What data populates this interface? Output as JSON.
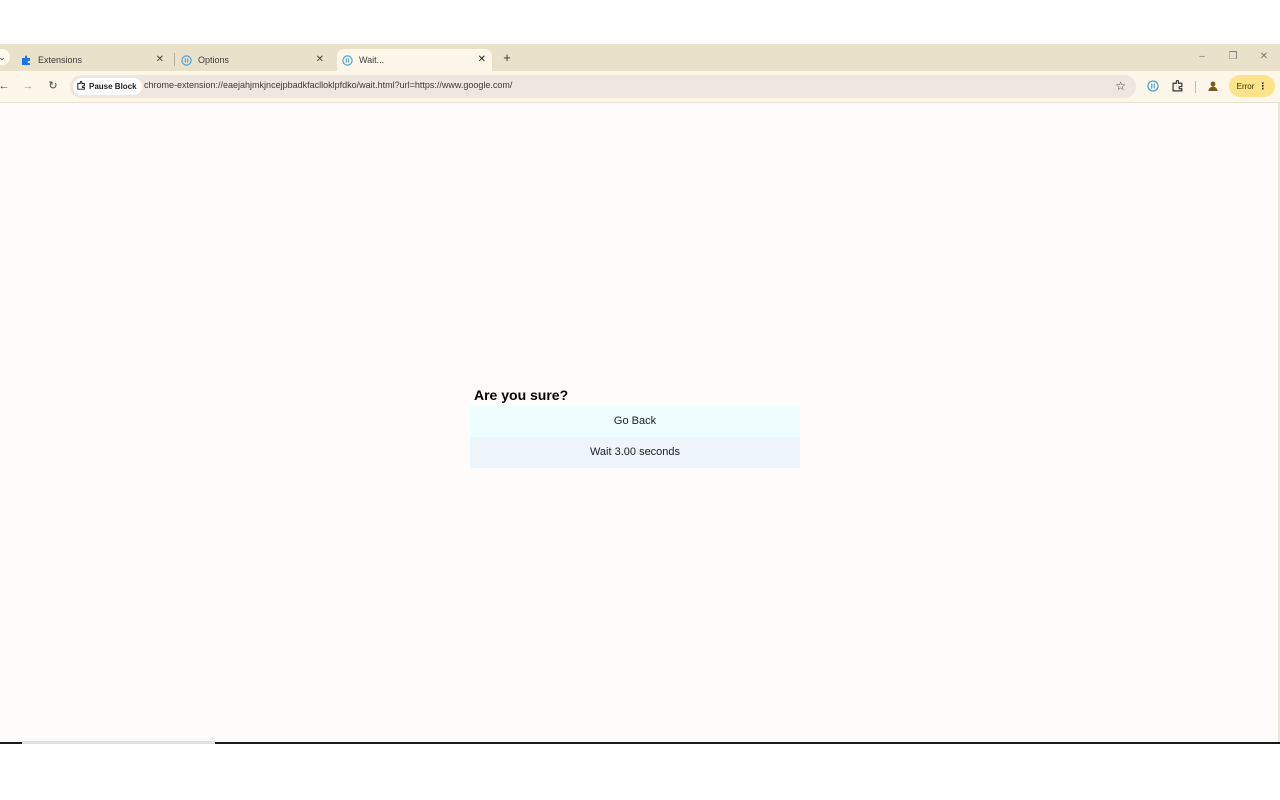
{
  "browser": {
    "tabs": [
      {
        "label": "Extensions",
        "icon": "puzzle-icon"
      },
      {
        "label": "Options",
        "icon": "pause-circle-icon"
      },
      {
        "label": "Wait...",
        "icon": "pause-circle-icon",
        "active": true
      }
    ],
    "toolbar": {
      "chip_label": "Pause Block",
      "url": "chrome-extension://eaejahjmkjncejpbadkfaclloklpfdko/wait.html?url=https://www.google.com/",
      "error_label": "Error"
    },
    "colors": {
      "tabstrip": "#e9e1c9",
      "toolbar": "#fdf7ea",
      "omnibox": "#efe6e0",
      "error_button": "#fde48b"
    }
  },
  "dialog": {
    "title": "Are you sure?",
    "go_back_label": "Go Back",
    "wait_label": "Wait 3.00 seconds"
  }
}
